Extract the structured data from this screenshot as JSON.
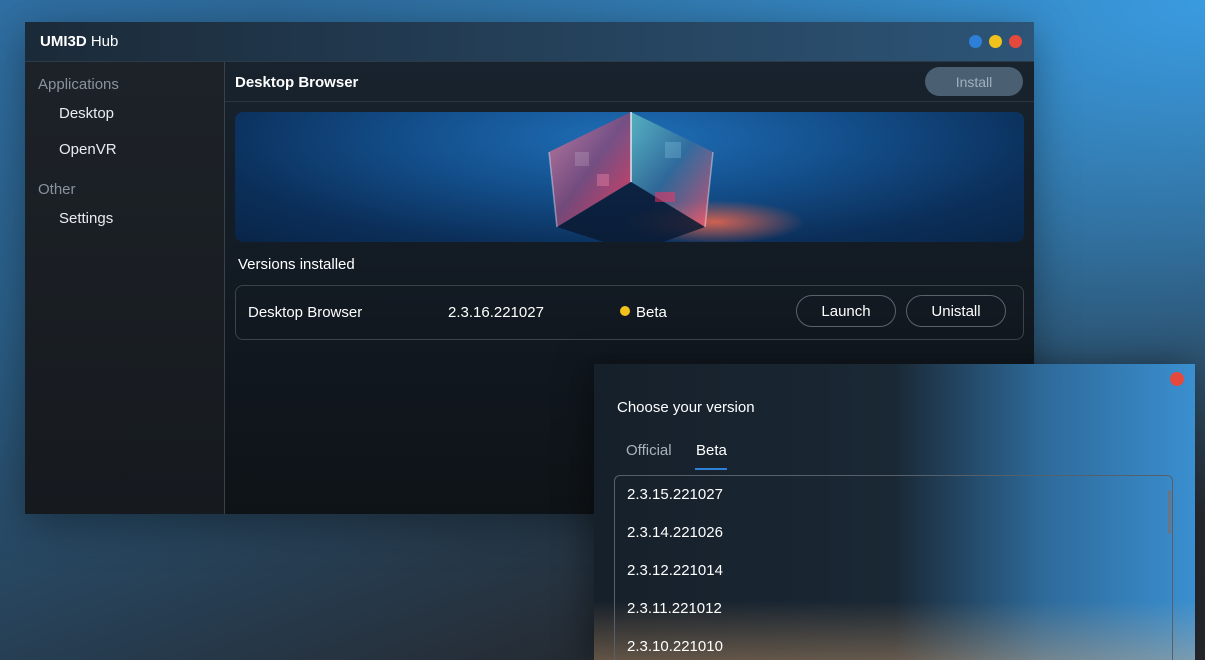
{
  "window": {
    "brand": "UMI3D",
    "name": "Hub"
  },
  "sidebar": {
    "sections": [
      {
        "label": "Applications",
        "items": [
          {
            "label": "Desktop"
          },
          {
            "label": "OpenVR"
          }
        ]
      },
      {
        "label": "Other",
        "items": [
          {
            "label": "Settings"
          }
        ]
      }
    ]
  },
  "main": {
    "title": "Desktop Browser",
    "install_label": "Install",
    "versions_label": "Versions installed",
    "installed": [
      {
        "name": "Desktop Browser",
        "version": "2.3.16.221027",
        "channel": "Beta",
        "channel_color": "#f1c21b",
        "launch_label": "Launch",
        "uninstall_label": "Unistall"
      }
    ]
  },
  "dialog": {
    "title": "Choose your version",
    "tabs": [
      {
        "label": "Official"
      },
      {
        "label": "Beta",
        "active": true
      }
    ],
    "versions": [
      "2.3.15.221027",
      "2.3.14.221026",
      "2.3.12.221014",
      "2.3.11.221012",
      "2.3.10.221010"
    ]
  },
  "colors": {
    "accent": "#2d7fd8",
    "warning": "#f1c21b",
    "close": "#e5483c"
  }
}
